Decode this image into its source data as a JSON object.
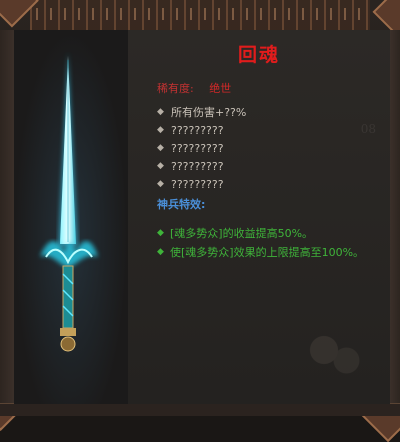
{
  "item": {
    "name": "回魂",
    "rarity_label": "稀有度:",
    "rarity_value": "绝世",
    "bg_number": "08",
    "stats": [
      "所有伤害+??%",
      "?????????",
      "?????????",
      "?????????",
      "?????????"
    ],
    "divine_title": "神兵特效:",
    "effects": [
      "[魂多势众]的收益提高50%。",
      "使[魂多势众]效果的上限提高至100%。"
    ]
  },
  "colors": {
    "title": "#e11c1c",
    "rarity": "#d22828",
    "stat_text": "#c9c2b8",
    "section_title": "#4a8fd8",
    "effect_text": "#3fb43a",
    "weapon_glow": "#5ee8ff"
  },
  "icons": [
    "diamond-bullet-icon",
    "glowing-sword-icon"
  ]
}
